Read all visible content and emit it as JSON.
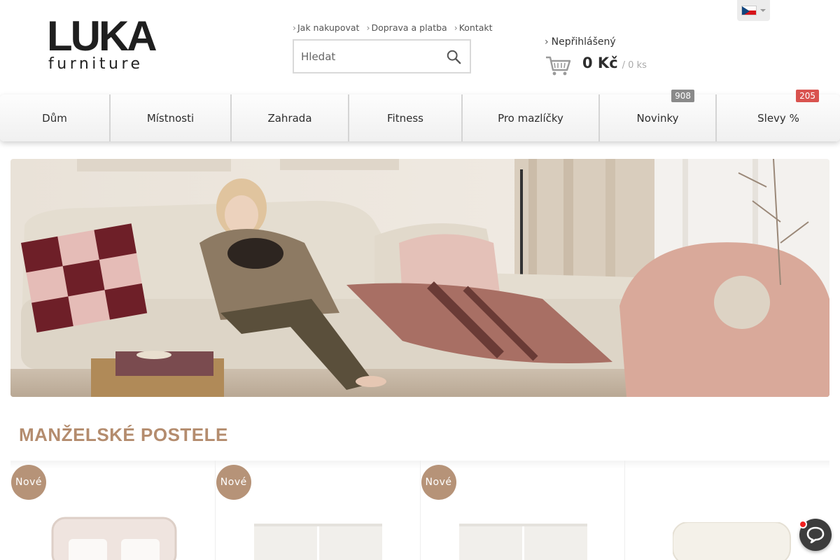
{
  "brand": {
    "name_main": "LUKA",
    "name_sub": "furniture"
  },
  "toplinks": [
    "Jak nakupovat",
    "Doprava a platba",
    "Kontakt"
  ],
  "search": {
    "placeholder": "Hledat"
  },
  "language": {
    "current": "CZ flag"
  },
  "account": {
    "login_label": "Nepřihlášený"
  },
  "cart": {
    "total": "0 Kč",
    "count": "/ 0 ks"
  },
  "nav": [
    {
      "label": "Dům"
    },
    {
      "label": "Místnosti"
    },
    {
      "label": "Zahrada"
    },
    {
      "label": "Fitness"
    },
    {
      "label": "Pro mazlíčky"
    },
    {
      "label": "Novinky",
      "badge": "908"
    },
    {
      "label": "Slevy %",
      "badge": "205"
    }
  ],
  "section": {
    "title": "MANŽELSKÉ POSTELE"
  },
  "products": [
    {
      "badge": "Nové"
    },
    {
      "badge": "Nové"
    },
    {
      "badge": "Nové"
    },
    {
      "badge": ""
    }
  ],
  "colors": {
    "accent": "#b69378",
    "title": "#b48c6e",
    "badge_gray": "#8a8a8a",
    "badge_red": "#d9534f"
  }
}
